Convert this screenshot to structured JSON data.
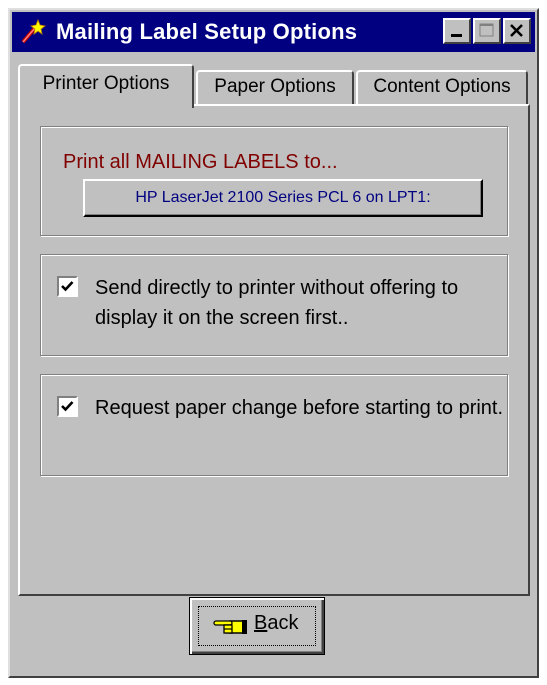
{
  "window": {
    "title": "Mailing Label Setup Options",
    "controls": {
      "minimize": "minimize-icon",
      "maximize": "maximize-icon",
      "close": "close-icon"
    }
  },
  "tabs": [
    {
      "label": "Printer Options",
      "active": true
    },
    {
      "label": "Paper Options",
      "active": false
    },
    {
      "label": "Content Options",
      "active": false
    }
  ],
  "printer_group": {
    "label": "Print all MAILING LABELS to...",
    "printer_button": "HP LaserJet 2100 Series PCL 6 on LPT1:"
  },
  "options": [
    {
      "label": "Send directly to printer without offering to display it on the screen first..",
      "checked": true
    },
    {
      "label": "Request paper change before starting to print.",
      "checked": true
    }
  ],
  "footer": {
    "back_button": {
      "mnemonic": "B",
      "rest": "ack",
      "icon": "pointing-hand-icon"
    }
  },
  "colors": {
    "titlebar": "#000080",
    "face": "#c0c0c0",
    "group_label": "#800000",
    "printer_text": "#000080"
  }
}
